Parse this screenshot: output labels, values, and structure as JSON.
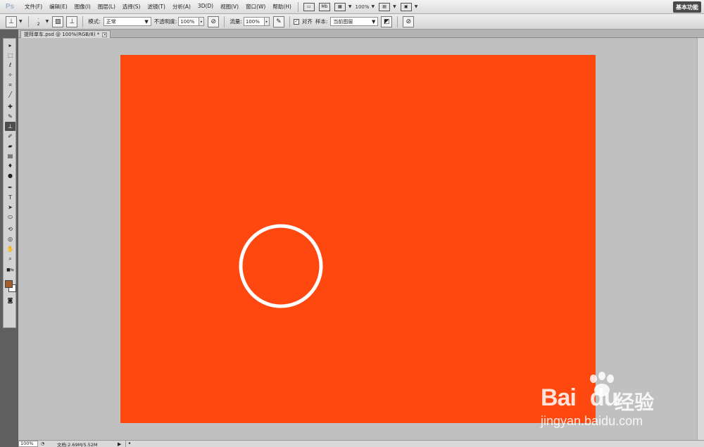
{
  "app": {
    "logo": "Ps",
    "workspace": "基本功能"
  },
  "menu": {
    "items": [
      "文件(F)",
      "编辑(E)",
      "图像(I)",
      "图层(L)",
      "选择(S)",
      "滤镜(T)",
      "分析(A)",
      "3D(D)",
      "视图(V)",
      "窗口(W)",
      "帮助(H)"
    ],
    "zoom": "100%",
    "mb_label": "Mb"
  },
  "options": {
    "brush_size": "2",
    "mode_label": "模式:",
    "mode_value": "正常",
    "opacity_label": "不透明度:",
    "opacity_value": "100%",
    "flow_label": "流量:",
    "flow_value": "100%",
    "aligned_label": "对齐",
    "sample_label": "样本:",
    "sample_value": "当前图层"
  },
  "document": {
    "tab_title": "提拜单车.psd @ 100%(RGB/8) *"
  },
  "canvas": {
    "fill": "#ff4810",
    "stroke": "#ffffff"
  },
  "status": {
    "zoom": "100%",
    "doc_info": "文档:2.69M/5.52M"
  },
  "watermark": {
    "logo": "Bai du",
    "logo_a": "Bai",
    "logo_b": "du",
    "product": "经验",
    "url": "jingyan.baidu.com"
  }
}
